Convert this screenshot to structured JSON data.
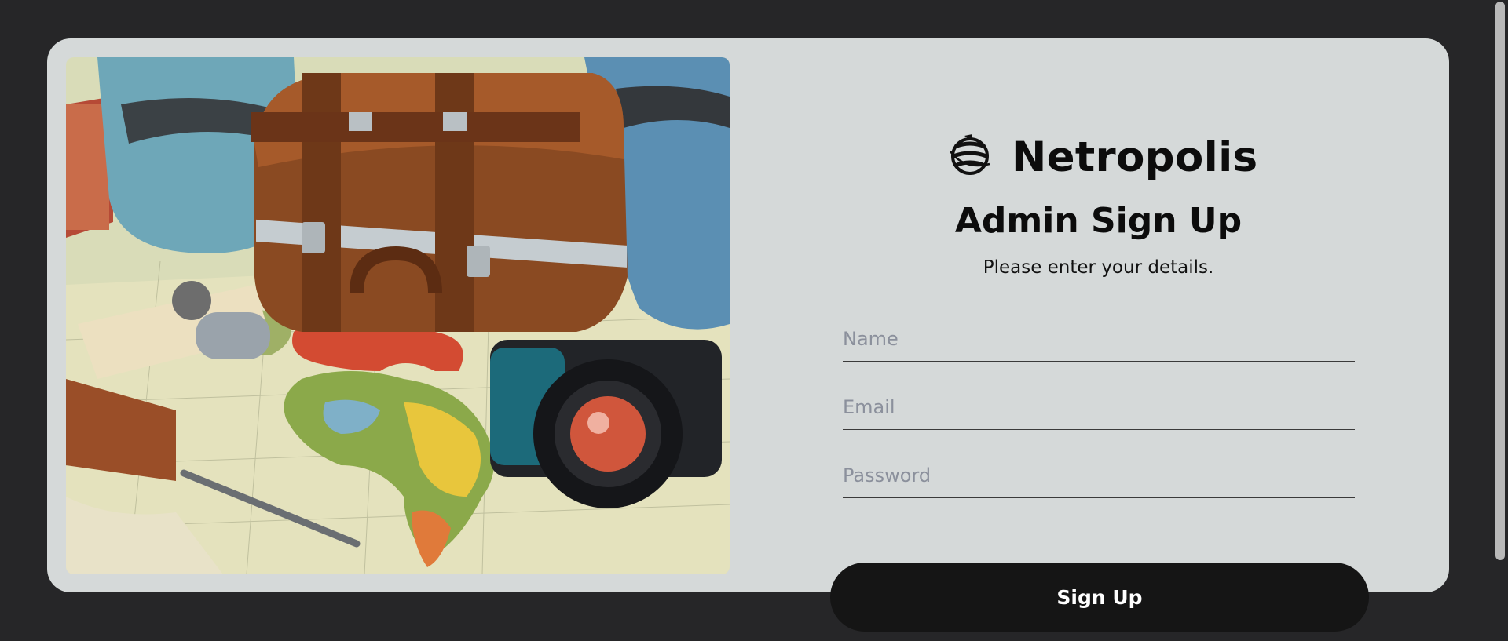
{
  "brand": {
    "name": "Netropolis",
    "logo_icon": "globe-rings-icon"
  },
  "form": {
    "title": "Admin Sign Up",
    "subtitle": "Please enter your details.",
    "name_placeholder": "Name",
    "email_placeholder": "Email",
    "password_placeholder": "Password",
    "submit_label": "Sign Up"
  },
  "hero": {
    "image_subject": "travel-illustration-suitcase-camera-map"
  },
  "colors": {
    "page_bg": "#262628",
    "card_bg": "#d5d9d9",
    "button_bg": "#151515",
    "placeholder": "#8b909c"
  }
}
